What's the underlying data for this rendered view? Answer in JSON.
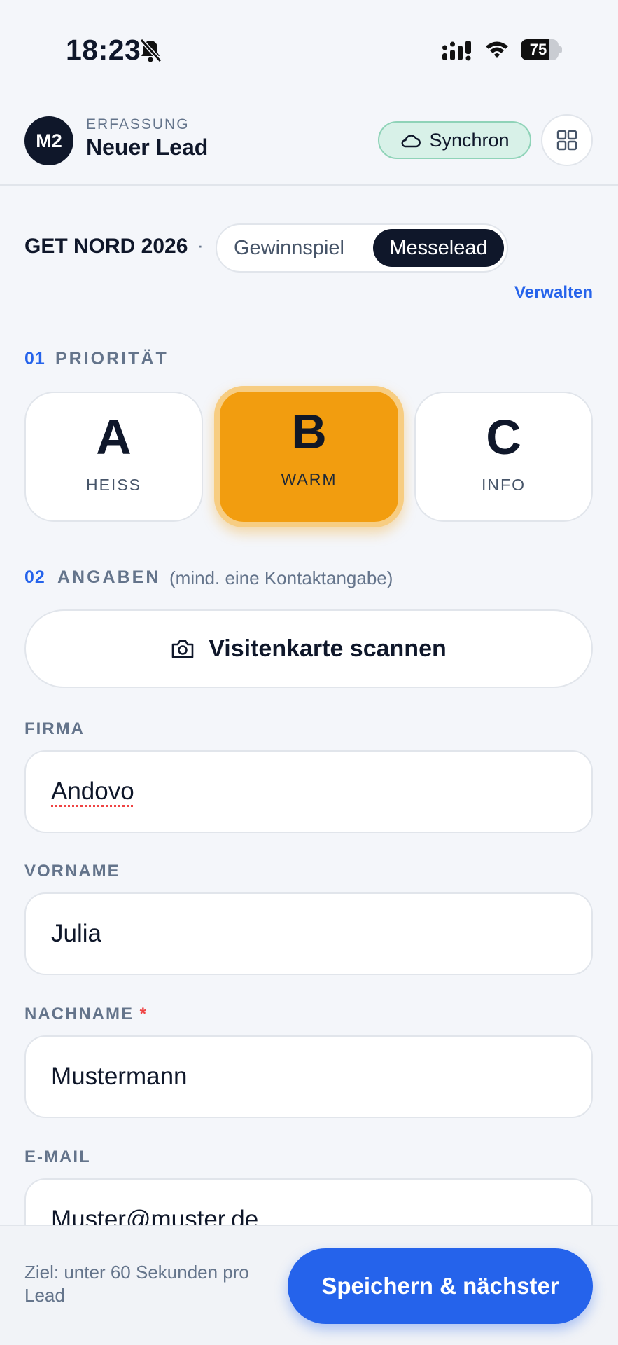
{
  "status_bar": {
    "time": "18:23",
    "battery_percent": 75,
    "battery_label": "75"
  },
  "header": {
    "avatar": "M2",
    "eyebrow": "ERFASSUNG",
    "title": "Neuer Lead",
    "sync_label": "Synchron",
    "menu_icon": "grid-icon"
  },
  "event": {
    "name": "GET NORD 2026",
    "separator": "·",
    "modes": [
      "Gewinnspiel",
      "Messelead"
    ],
    "selected_mode": "Messelead",
    "manage_label": "Verwalten"
  },
  "priority": {
    "number": "01",
    "label": "PRIORITÄT",
    "options": [
      {
        "letter": "A",
        "sub": "HEISS"
      },
      {
        "letter": "B",
        "sub": "WARM"
      },
      {
        "letter": "C",
        "sub": "INFO"
      }
    ],
    "selected": "B"
  },
  "details": {
    "number": "02",
    "label": "ANGABEN",
    "hint": "(mind. eine Kontaktangabe)",
    "scan_label": "Visitenkarte scannen",
    "fields": {
      "company": {
        "label": "FIRMA",
        "value": "Andovo"
      },
      "first_name": {
        "label": "VORNAME",
        "value": "Julia"
      },
      "last_name": {
        "label": "NACHNAME",
        "required_mark": "*",
        "value": "Mustermann"
      },
      "email": {
        "label": "E-MAIL",
        "value": "Muster@muster.de"
      }
    }
  },
  "footer": {
    "goal": "Ziel: unter 60 Sekunden pro Lead",
    "save_label": "Speichern & nächster"
  },
  "colors": {
    "accent": "#2563eb",
    "priority_active": "#f29d0f",
    "sync_bg": "#d8f1e8",
    "dark": "#0f172a"
  }
}
